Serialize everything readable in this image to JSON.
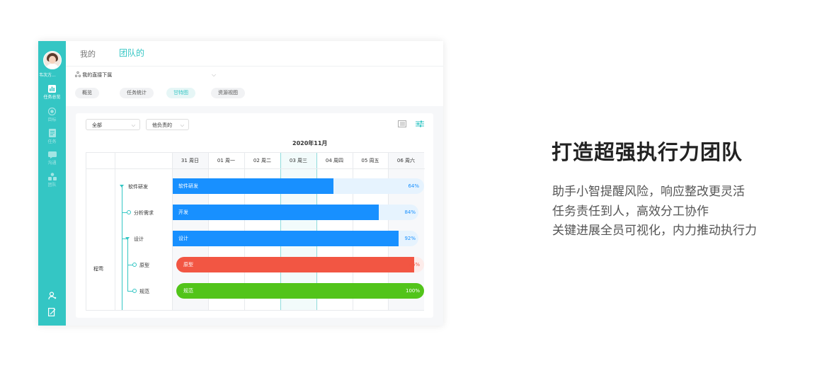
{
  "sidebar": {
    "user_name": "韦次方...",
    "items": [
      {
        "label": "任务总览",
        "icon": "bar-chart-icon",
        "active": true
      },
      {
        "label": "目标",
        "icon": "target-icon"
      },
      {
        "label": "任务",
        "icon": "document-icon"
      },
      {
        "label": "沟通",
        "icon": "chat-icon"
      },
      {
        "label": "团队",
        "icon": "team-icon"
      }
    ],
    "bottom_icons": [
      "user-add-icon",
      "edit-icon"
    ]
  },
  "header": {
    "tabs": [
      {
        "label": "我的"
      },
      {
        "label": "团队的",
        "active": true
      }
    ]
  },
  "subordinate_select": {
    "value": "我的直接下属"
  },
  "view_pills": [
    {
      "label": "概览"
    },
    {
      "label": "任务统计"
    },
    {
      "label": "甘特图",
      "active": true
    },
    {
      "label": "资源视图"
    }
  ],
  "filters": {
    "scope": "全部",
    "role": "他负责的"
  },
  "gantt": {
    "month": "2020年11月",
    "days": [
      "31 周日",
      "01 周一",
      "02 周二",
      "03 周三",
      "04 周四",
      "05 周五",
      "06 周六"
    ],
    "owner": "程莺",
    "tasks": [
      {
        "name": "软件研发",
        "bar_label": "软件研发",
        "pct": "64%",
        "progress": 0.64,
        "color": "#1890ff",
        "track": "#e6f3fe",
        "pct_color": "#1890ff"
      },
      {
        "name": "分析需求",
        "bar_label": "开发",
        "pct": "84%",
        "progress": 0.84,
        "color": "#1890ff",
        "track": "#e6f3fe",
        "pct_color": "#1890ff"
      },
      {
        "name": "设计",
        "bar_label": "设计",
        "pct": "92%",
        "progress": 0.92,
        "color": "#1890ff",
        "track": "#e6f3fe",
        "pct_color": "#1890ff"
      },
      {
        "name": "原型",
        "bar_label": "原型",
        "pct": "96%",
        "progress": 0.96,
        "color": "#f25643",
        "track": "#fdecea",
        "pct_color": "#f25643"
      },
      {
        "name": "规范",
        "bar_label": "规范",
        "pct": "100%",
        "progress": 1.0,
        "color": "#52c41a",
        "track": "#eaf7e3",
        "pct_color": "#ffffff"
      }
    ]
  },
  "marketing": {
    "headline": "打造超强执行力团队",
    "lines": [
      "助手小智提醒风险，响应整改更灵活",
      "任务责任到人，高效分工协作",
      "关键进展全员可视化，内力推动执行力"
    ]
  },
  "colors": {
    "accent": "#34c6c4",
    "blue": "#1890ff",
    "red": "#f25643",
    "green": "#52c41a"
  }
}
